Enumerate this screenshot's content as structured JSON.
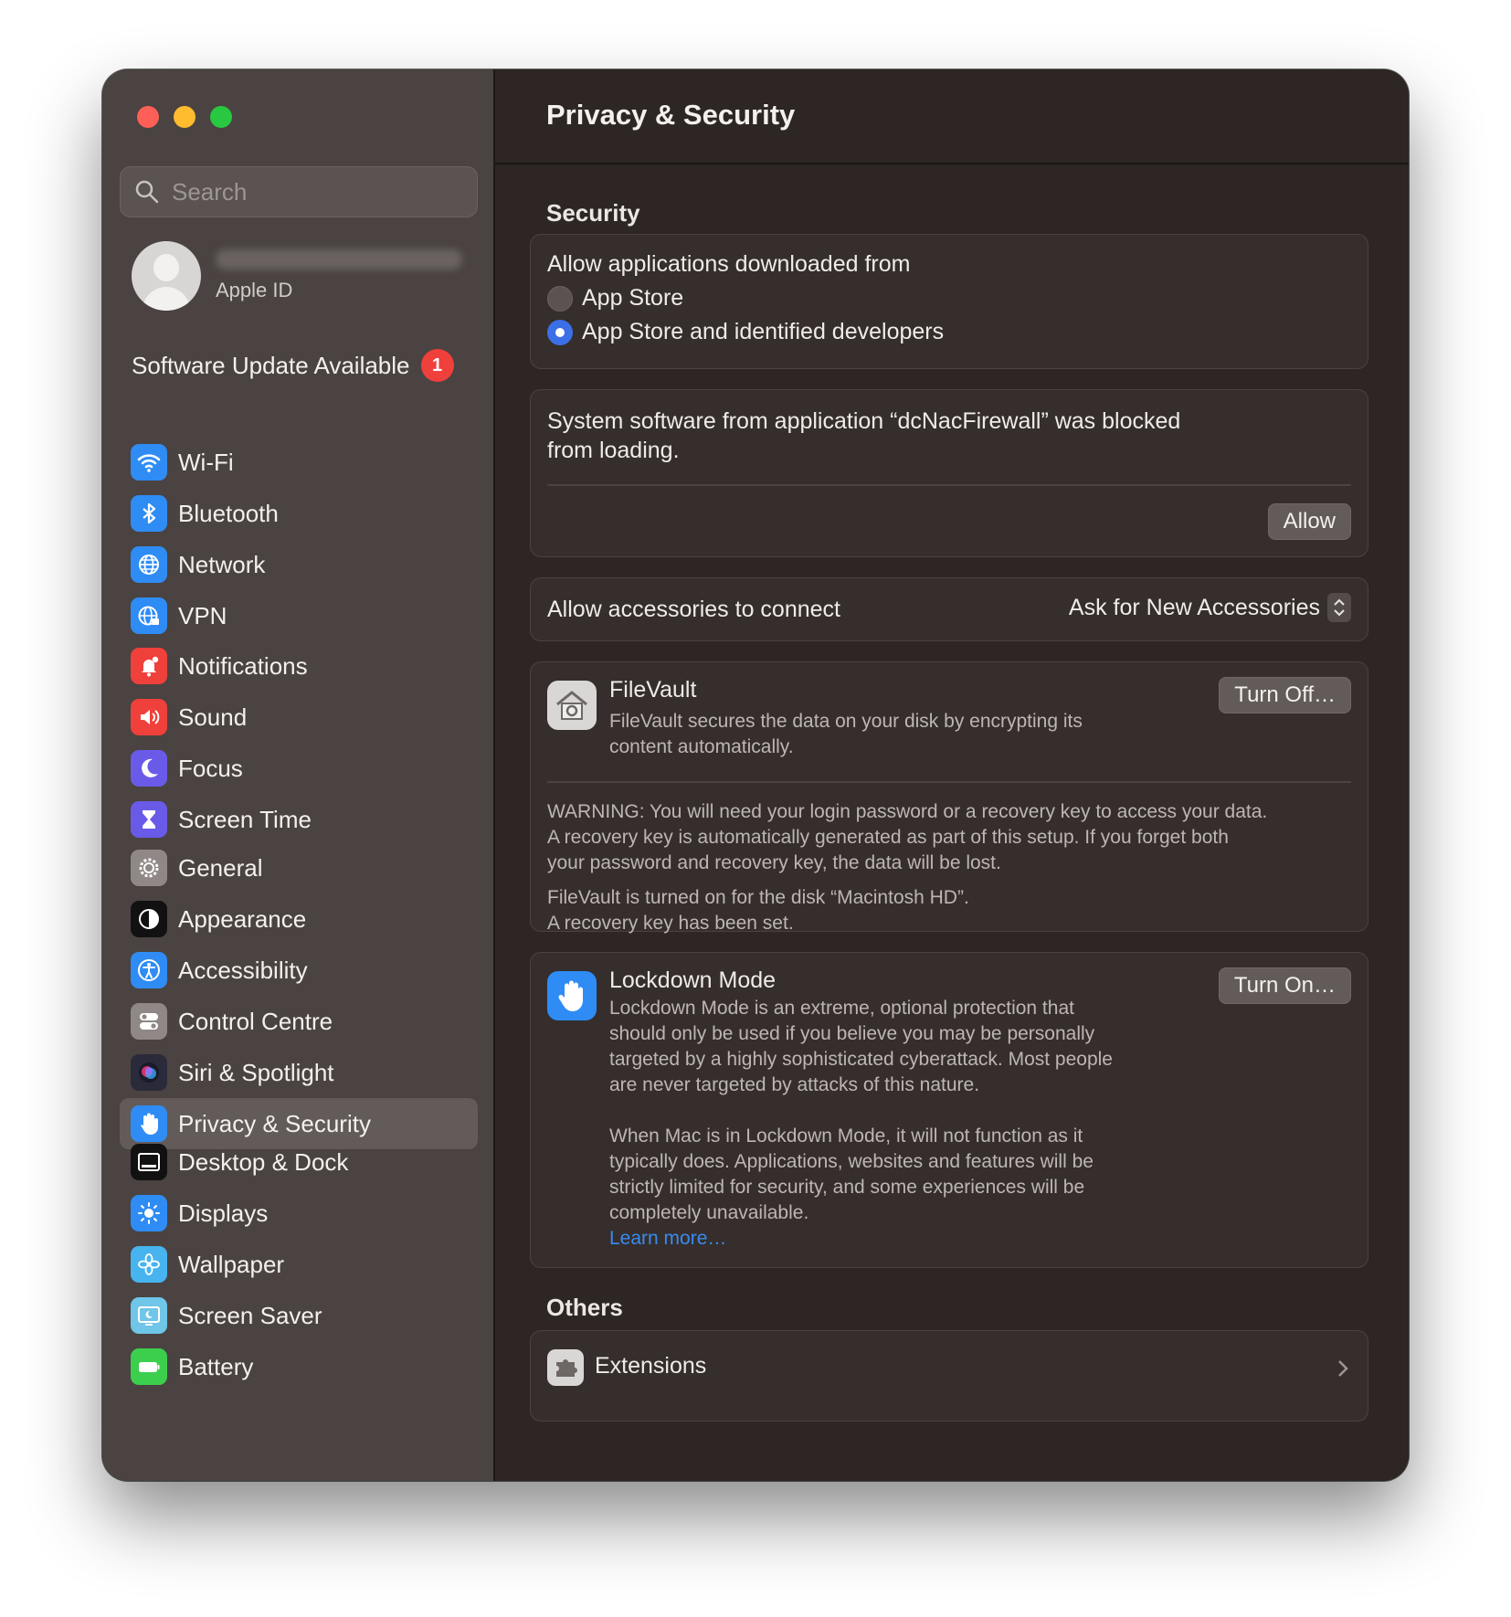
{
  "sidebar": {
    "search_placeholder": "Search",
    "account_label": "Apple ID",
    "update_label": "Software Update Available",
    "update_count": "1",
    "groups": [
      [
        {
          "label": "Wi-Fi",
          "icon": "wifi-icon",
          "color": "#2f8cf5"
        },
        {
          "label": "Bluetooth",
          "icon": "bluetooth-icon",
          "color": "#2f8cf5"
        },
        {
          "label": "Network",
          "icon": "globe-icon",
          "color": "#2f8cf5"
        },
        {
          "label": "VPN",
          "icon": "vpn-globe-icon",
          "color": "#2f8cf5"
        }
      ],
      [
        {
          "label": "Notifications",
          "icon": "bell-icon",
          "color": "#f0403c"
        },
        {
          "label": "Sound",
          "icon": "speaker-icon",
          "color": "#f0403c"
        },
        {
          "label": "Focus",
          "icon": "moon-icon",
          "color": "#6a5ae8"
        },
        {
          "label": "Screen Time",
          "icon": "hourglass-icon",
          "color": "#6a5ae8"
        }
      ],
      [
        {
          "label": "General",
          "icon": "gear-icon",
          "color": "#8f8886"
        },
        {
          "label": "Appearance",
          "icon": "appearance-icon",
          "color": "#111111"
        },
        {
          "label": "Accessibility",
          "icon": "accessibility-icon",
          "color": "#2f8cf5"
        },
        {
          "label": "Control Centre",
          "icon": "toggles-icon",
          "color": "#8f8886"
        },
        {
          "label": "Siri & Spotlight",
          "icon": "siri-icon",
          "color": "#2a2a3a"
        },
        {
          "label": "Privacy & Security",
          "icon": "hand-icon",
          "color": "#2f8cf5",
          "selected": true
        }
      ],
      [
        {
          "label": "Desktop & Dock",
          "icon": "dock-icon",
          "color": "#111111"
        },
        {
          "label": "Displays",
          "icon": "sun-icon",
          "color": "#2f8cf5"
        },
        {
          "label": "Wallpaper",
          "icon": "flower-icon",
          "color": "#47b4f0"
        },
        {
          "label": "Screen Saver",
          "icon": "screensaver-icon",
          "color": "#6fc6e8"
        },
        {
          "label": "Battery",
          "icon": "battery-icon",
          "color": "#3ccf4e"
        }
      ]
    ]
  },
  "main": {
    "title": "Privacy & Security",
    "security_title": "Security",
    "downloads": {
      "heading": "Allow applications downloaded from",
      "option_app_store": "App Store",
      "option_identified": "App Store and identified developers",
      "selected": "identified"
    },
    "blocked": {
      "message_line1": "System software from application “dcNacFirewall” was blocked",
      "message_line2": "from loading.",
      "allow_label": "Allow"
    },
    "accessories": {
      "label": "Allow accessories to connect",
      "value": "Ask for New Accessories"
    },
    "filevault": {
      "title": "FileVault",
      "desc_line1": "FileVault secures the data on your disk by encrypting its",
      "desc_line2": "content automatically.",
      "button": "Turn Off…",
      "warning_line1": "WARNING: You will need your login password or a recovery key to access your data.",
      "warning_line2": "A recovery key is automatically generated as part of this setup. If you forget both",
      "warning_line3": "your password and recovery key, the data will be lost.",
      "status_line1": "FileVault is turned on for the disk “Macintosh HD”.",
      "status_line2": "A recovery key has been set."
    },
    "lockdown": {
      "title": "Lockdown Mode",
      "button": "Turn On…",
      "p1_line1": "Lockdown Mode is an extreme, optional protection that",
      "p1_line2": "should only be used if you believe you may be personally",
      "p1_line3": "targeted by a highly sophisticated cyberattack. Most people",
      "p1_line4": "are never targeted by attacks of this nature.",
      "p2_line1": "When Mac is in Lockdown Mode, it will not function as it",
      "p2_line2": "typically does. Applications, websites and features will be",
      "p2_line3": "strictly limited for security, and some experiences will be",
      "p2_line4": "completely unavailable.",
      "learn_more": "Learn more…"
    },
    "others_title": "Others",
    "extensions_label": "Extensions"
  }
}
